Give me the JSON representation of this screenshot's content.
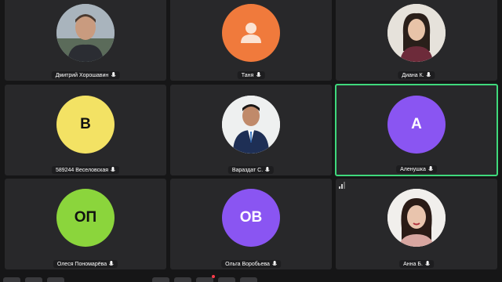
{
  "participants": [
    {
      "name": "Дмитрий Хорошавин",
      "avatar_type": "photo",
      "avatar_style": "man-dark-shirt",
      "active": false
    },
    {
      "name": "Таня",
      "avatar_type": "placeholder",
      "avatar_color": "#f07a3c",
      "active": false
    },
    {
      "name": "Диана К.",
      "avatar_type": "photo",
      "avatar_style": "woman-dark-hair",
      "active": false
    },
    {
      "name": "589244 Веселовская",
      "avatar_type": "initials",
      "initials": "В",
      "avatar_color": "#f3e264",
      "initials_color": "#111111",
      "active": false
    },
    {
      "name": "Вараздат С.",
      "avatar_type": "photo",
      "avatar_style": "man-suit",
      "active": false
    },
    {
      "name": "Аленушка",
      "avatar_type": "initials",
      "initials": "А",
      "avatar_color": "#8a55f2",
      "initials_color": "#ffffff",
      "active": true
    },
    {
      "name": "Олеся Пономарёва",
      "avatar_type": "initials",
      "initials": "ОП",
      "avatar_color": "#8bd53c",
      "initials_color": "#111111",
      "active": false
    },
    {
      "name": "Ольга Воробьева",
      "avatar_type": "initials",
      "initials": "ОВ",
      "avatar_color": "#8a55f2",
      "initials_color": "#ffffff",
      "active": false
    },
    {
      "name": "Анна Б.",
      "avatar_type": "photo",
      "avatar_style": "woman-red-lips",
      "active": false,
      "signal_icon": "signal-bars-icon"
    }
  ],
  "colors": {
    "background": "#161617",
    "tile": "#28282a",
    "active_border": "#3fd97c",
    "record_dot": "#ff3b4a"
  },
  "icons": {
    "name_icon": "microphone-icon",
    "signal": "signal-bars-icon"
  }
}
